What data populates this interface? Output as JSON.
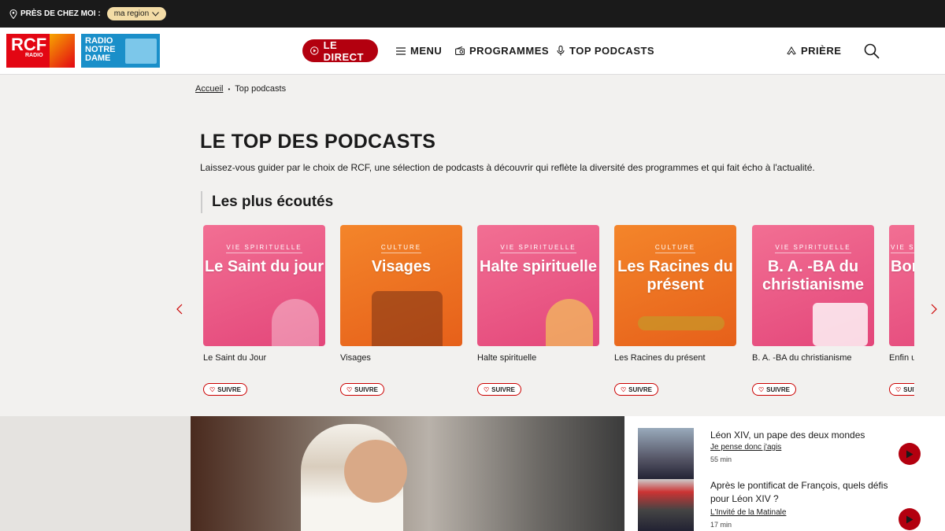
{
  "topbar": {
    "near_label": "PRÈS DE CHEZ MOI :",
    "region_label": "ma region"
  },
  "logos": {
    "rcf_text": "RCF",
    "rcf_sub": "RADIO",
    "rnd_line1": "RADIO",
    "rnd_line2": "NOTRE",
    "rnd_line3": "DAME"
  },
  "nav": {
    "direct": "LE DIRECT",
    "menu": "MENU",
    "programmes": "PROGRAMMES",
    "top_podcasts": "TOP PODCASTS",
    "priere": "PRIÈRE"
  },
  "breadcrumb": {
    "home": "Accueil",
    "separator": "•",
    "current": "Top podcasts"
  },
  "page": {
    "title": "LE TOP DES PODCASTS",
    "intro": "Laissez-vous guider par le choix de RCF, une sélection de podcasts à découvrir qui reflète la diversité des programmes et qui fait écho à l'actualité.",
    "section_title": "Les plus écoutés"
  },
  "podcasts": [
    {
      "category": "VIE SPIRITUELLE",
      "thumb_title": "Le Saint du jour",
      "name": "Le Saint du Jour",
      "follow": "SUIVRE",
      "theme": "pink"
    },
    {
      "category": "CULTURE",
      "thumb_title": "Visages",
      "name": "Visages",
      "follow": "SUIVRE",
      "theme": "orange"
    },
    {
      "category": "VIE SPIRITUELLE",
      "thumb_title": "Halte spirituelle",
      "name": "Halte spirituelle",
      "follow": "SUIVRE",
      "theme": "pink"
    },
    {
      "category": "CULTURE",
      "thumb_title": "Les Racines du présent",
      "name": "Les Racines du présent",
      "follow": "SUIVRE",
      "theme": "orange"
    },
    {
      "category": "VIE SPIRITUELLE",
      "thumb_title": "B. A. -BA du christianisme",
      "name": "B. A. -BA du christianisme",
      "follow": "SUIVRE",
      "theme": "pink"
    },
    {
      "category": "VIE SPIRITUELLE",
      "thumb_title": "Bon",
      "name": "Enfin u",
      "follow": "SUIVRE",
      "theme": "pink"
    }
  ],
  "news": [
    {
      "title": "Léon XIV, un pape des deux mondes",
      "show": "Je pense donc j'agis",
      "duration": "55 min"
    },
    {
      "title": "Après le pontificat de François, quels défis pour Léon XIV ?",
      "show": "L'Invité de la Matinale",
      "duration": "17 min"
    }
  ],
  "colors": {
    "accent": "#b3000f",
    "topbar": "#1a1a1a",
    "region_pill": "#f3dca6",
    "pink_card": "#e3467a",
    "orange_card": "#e6601a"
  }
}
